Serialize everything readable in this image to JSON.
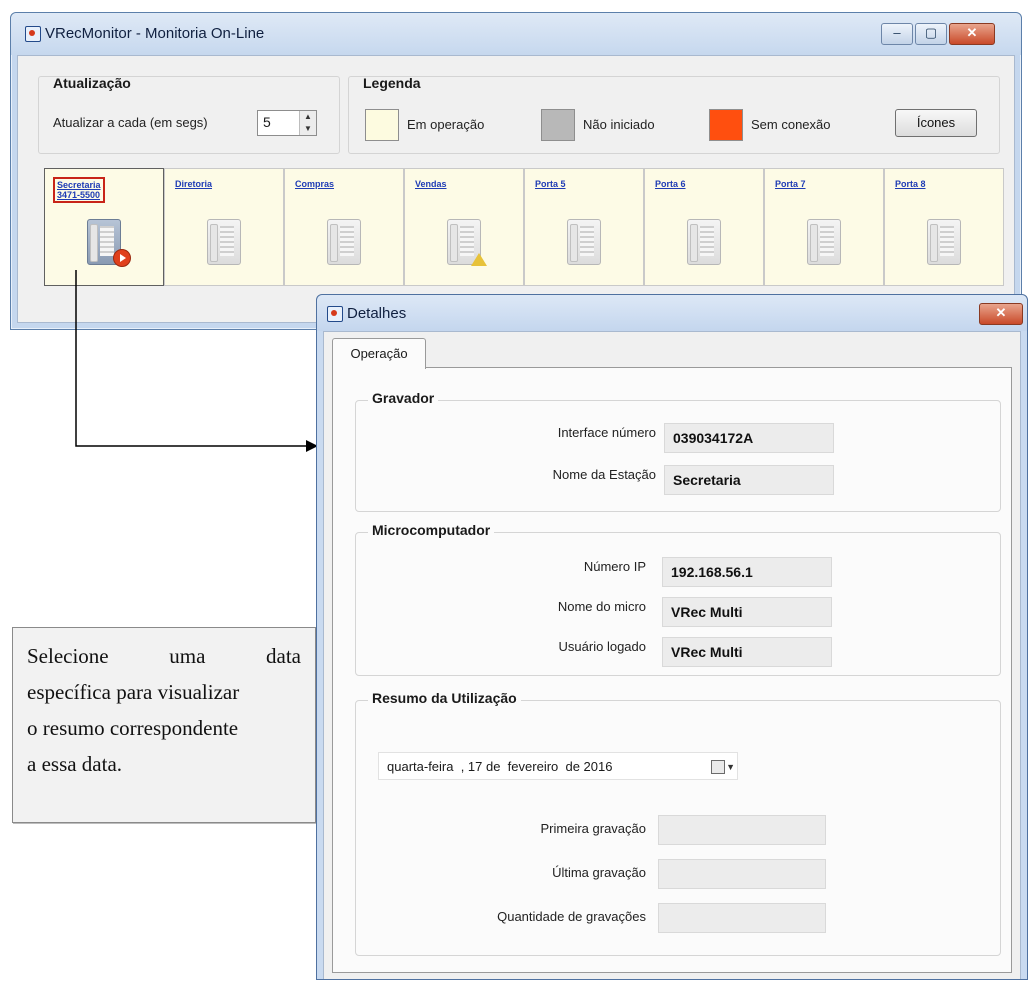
{
  "main_window": {
    "title": "VRecMonitor - Monitoria On-Line",
    "controls": {
      "minimize": "–",
      "maximize": "▢",
      "close": "✕"
    },
    "update_group": {
      "title": "Atualização",
      "label": "Atualizar a cada (em segs)",
      "value": "5"
    },
    "legend_group": {
      "title": "Legenda",
      "items": [
        {
          "label": "Em operação",
          "color": "#fdfbe0"
        },
        {
          "label": "Não iniciado",
          "color": "#b8b8b8"
        },
        {
          "label": "Sem conexão",
          "color": "#ff4f0f"
        }
      ],
      "icons_button": "Ícones"
    },
    "ports": [
      {
        "label_line1": "Secretaria",
        "label_line2": "3471-5500",
        "selected": true,
        "status": "recording"
      },
      {
        "label_line1": "Diretoria",
        "label_line2": "",
        "selected": false,
        "status": "idle"
      },
      {
        "label_line1": "Compras",
        "label_line2": "",
        "selected": false,
        "status": "idle"
      },
      {
        "label_line1": "Vendas",
        "label_line2": "",
        "selected": false,
        "status": "warning"
      },
      {
        "label_line1": "Porta 5",
        "label_line2": "",
        "selected": false,
        "status": "idle"
      },
      {
        "label_line1": "Porta 6",
        "label_line2": "",
        "selected": false,
        "status": "idle"
      },
      {
        "label_line1": "Porta 7",
        "label_line2": "",
        "selected": false,
        "status": "idle"
      },
      {
        "label_line1": "Porta 8",
        "label_line2": "",
        "selected": false,
        "status": "idle"
      }
    ]
  },
  "callout": {
    "lines": [
      [
        "Selecione",
        "uma",
        "data"
      ],
      [
        "específica para visualizar"
      ],
      [
        "o resumo correspondente"
      ],
      [
        "a essa data."
      ]
    ]
  },
  "details": {
    "title": "Detalhes",
    "close": "✕",
    "tab": "Operação",
    "gravador": {
      "title": "Gravador",
      "interface_label": "Interface número",
      "interface_value": "039034172A",
      "station_label": "Nome da Estação",
      "station_value": "Secretaria"
    },
    "micro": {
      "title": "Microcomputador",
      "ip_label": "Número IP",
      "ip_value": "192.168.56.1",
      "name_label": "Nome do micro",
      "name_value": "VRec Multi",
      "user_label": "Usuário logado",
      "user_value": "VRec Multi"
    },
    "summary": {
      "title": "Resumo da Utilização",
      "date": "quarta-feira  , 17 de  fevereiro  de 2016",
      "first_label": "Primeira gravação",
      "first_value": "",
      "last_label": "Última gravação",
      "last_value": "",
      "count_label": "Quantidade de gravações",
      "count_value": ""
    }
  }
}
